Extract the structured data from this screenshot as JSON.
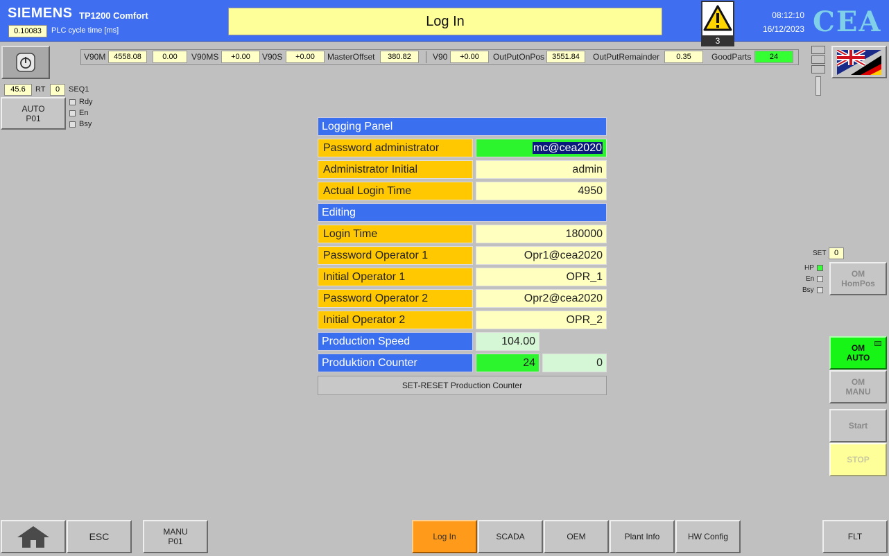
{
  "header": {
    "brand": "SIEMENS",
    "model": "TP1200 Comfort",
    "cycle_value": "0.10083",
    "cycle_label": "PLC cycle time [ms]",
    "title": "Log In",
    "alarm_count": "3",
    "time": "08:12:10",
    "date": "16/12/2023",
    "logo": "CEA"
  },
  "left": {
    "power_icon": "power-icon",
    "val1": "45.6",
    "rt_label": "RT",
    "rt_value": "0",
    "seq_label": "SEQ1",
    "auto_line1": "AUTO",
    "auto_line2": "P01",
    "led_rdy": "Rdy",
    "led_en": "En",
    "led_bsy": "Bsy"
  },
  "status_bar": {
    "v90m_label": "V90M",
    "v90m_value": "4558.08",
    "v90m_value2": "0.00",
    "v90ms_label": "V90MS",
    "v90ms_value": "+0.00",
    "v90s_label": "V90S",
    "v90s_value": "+0.00",
    "master_offset_label": "MasterOffset",
    "master_offset_value": "380.82",
    "v90_label": "V90",
    "v90_value": "+0.00",
    "output_on_pos_label": "OutPutOnPos",
    "output_on_pos_value": "3551.84",
    "output_remainder_label": "OutPutRemainder",
    "output_remainder_value": "0.35",
    "good_parts_label": "GoodParts",
    "good_parts_value": "24"
  },
  "panel": {
    "logging_header": "Logging Panel",
    "pwd_admin_label": "Password administrator",
    "pwd_admin_value": "mc@cea2020",
    "admin_initial_label": "Administrator Initial",
    "admin_initial_value": "admin",
    "actual_login_label": "Actual Login Time",
    "actual_login_value": "4950",
    "editing_header": "Editing",
    "login_time_label": "Login Time",
    "login_time_value": "180000",
    "pwd_op1_label": "Password Operator 1",
    "pwd_op1_value": "Opr1@cea2020",
    "init_op1_label": "Initial Operator 1",
    "init_op1_value": "OPR_1",
    "pwd_op2_label": "Password Operator 2",
    "pwd_op2_value": "Opr2@cea2020",
    "init_op2_label": "Initial Operator 2",
    "init_op2_value": "OPR_2",
    "prod_speed_label": "Production Speed",
    "prod_speed_value": "104.00",
    "prod_counter_label": "Produktion Counter",
    "prod_counter_value": "24",
    "prod_counter_value2": "0",
    "set_reset_label": "SET-RESET Production Counter"
  },
  "right": {
    "set_label": "SET",
    "set_value": "0",
    "led_hp": "HP",
    "led_en": "En",
    "led_bsy": "Bsy",
    "om_hompos_1": "OM",
    "om_hompos_2": "HomPos",
    "om_auto_1": "OM",
    "om_auto_2": "AUTO",
    "om_manu_1": "OM",
    "om_manu_2": "MANU",
    "start": "Start",
    "stop": "STOP"
  },
  "bottom": {
    "esc": "ESC",
    "manu_1": "MANU",
    "manu_2": "P01",
    "login": "Log In",
    "scada": "SCADA",
    "oem": "OEM",
    "plant_info": "Plant Info",
    "hw_config": "HW Config",
    "flt": "FLT"
  },
  "colors": {
    "header_blue": "#3f6ff0",
    "panel_blue": "#3a6fef",
    "label_orange": "#ffc800",
    "value_yellow": "#ffffc0",
    "active_green": "#2df52d",
    "active_tab": "#ff9a1a"
  }
}
